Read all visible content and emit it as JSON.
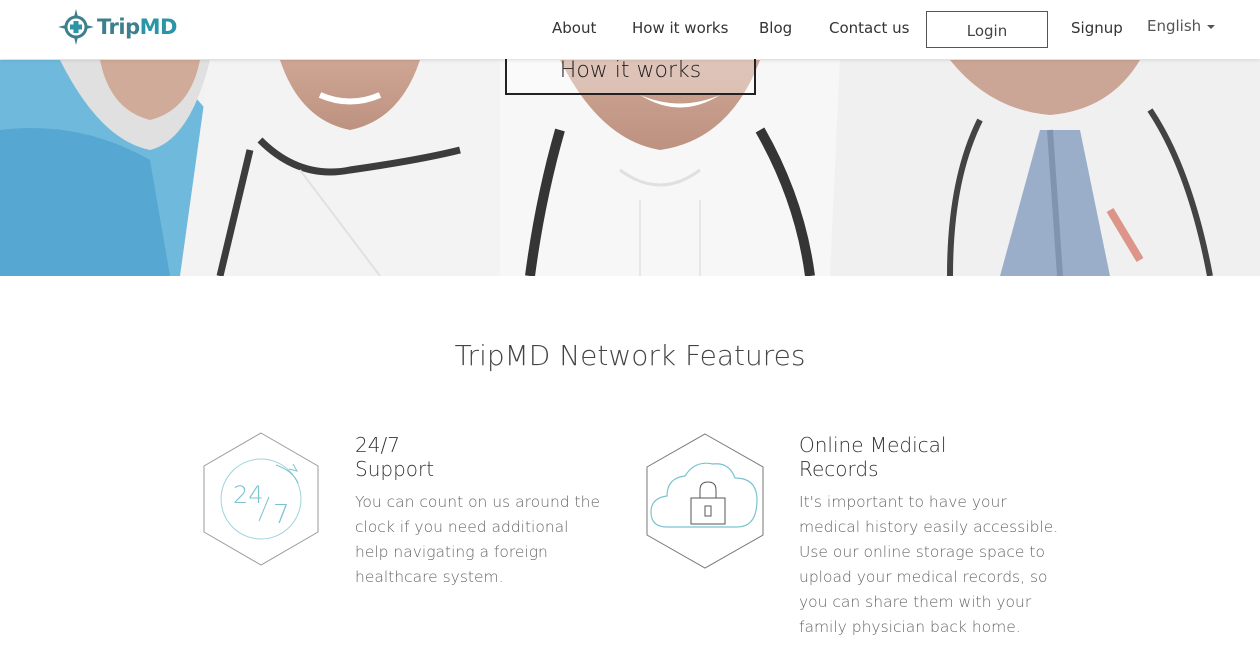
{
  "brand": {
    "prefix": "Trip",
    "suffix": "MD",
    "color_primary": "#3d7f8c",
    "color_accent": "#2a95a6"
  },
  "nav": {
    "about": "About",
    "how_it_works": "How it works",
    "blog": "Blog",
    "contact": "Contact us",
    "login": "Login",
    "signup": "Signup",
    "language": "English"
  },
  "hero": {
    "cta": "How it works"
  },
  "features": {
    "title": "TripMD Network Features",
    "items": [
      {
        "icon": "clock-24-7-icon",
        "icon_text_a": "24",
        "icon_text_b": "7",
        "title_line1": "24/7",
        "title_line2": "Support",
        "text": "You can count on us around the clock if you need additional help navigating a foreign healthcare system."
      },
      {
        "icon": "cloud-lock-icon",
        "title_line1": "Online Medical",
        "title_line2": "Records",
        "text": "It's important to have your medical history easily accessible. Use our online storage space to upload your medical records, so you can share them with your family physician back home."
      }
    ]
  }
}
